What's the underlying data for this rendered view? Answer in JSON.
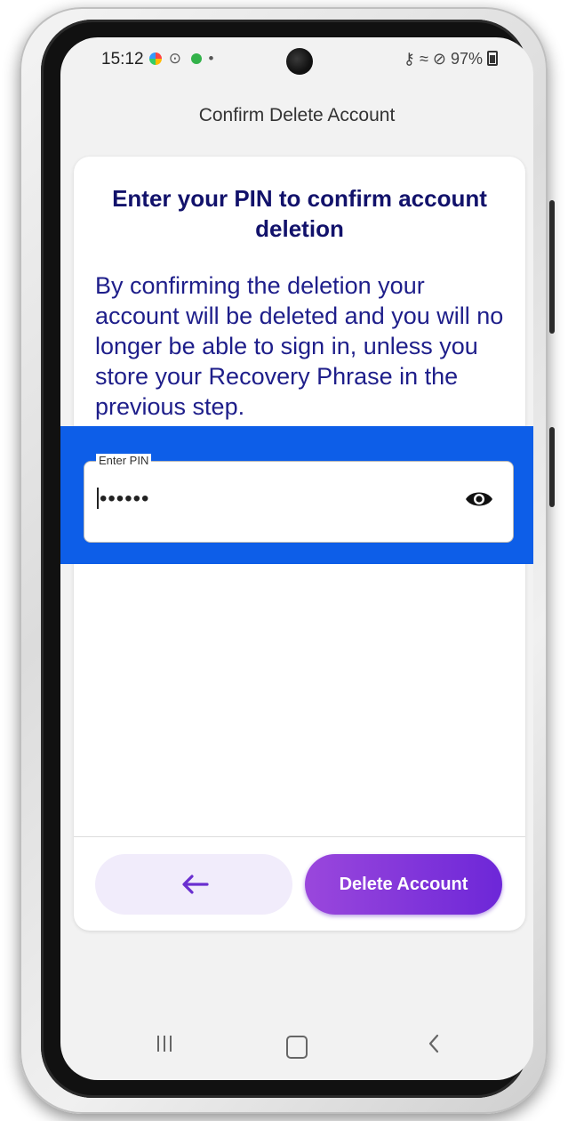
{
  "status_bar": {
    "time": "15:12",
    "right_icons": "⚷ ≈ ⊘",
    "battery": "97%"
  },
  "header": {
    "title": "Confirm Delete Account"
  },
  "card": {
    "heading": "Enter your PIN to confirm account deletion",
    "body": "By confirming the deletion your account will be deleted and you will no longer be able to sign in, unless you store your Recovery Phrase in the previous step."
  },
  "pin_field": {
    "label": "Enter PIN",
    "masked_value": "••••••",
    "icon": "eye-icon"
  },
  "buttons": {
    "back_icon": "arrow-left-icon",
    "delete_label": "Delete Account"
  },
  "nav_bar": {
    "recent_icon": "recent-apps-icon",
    "home_icon": "home-icon",
    "back_icon": "back-chevron-icon"
  },
  "colors": {
    "highlight": "#0d5ee8",
    "heading_text": "#12126b",
    "body_text": "#1e1e8a",
    "primary_button": "#7a2fd9",
    "secondary_button_bg": "#f1ecfb"
  }
}
